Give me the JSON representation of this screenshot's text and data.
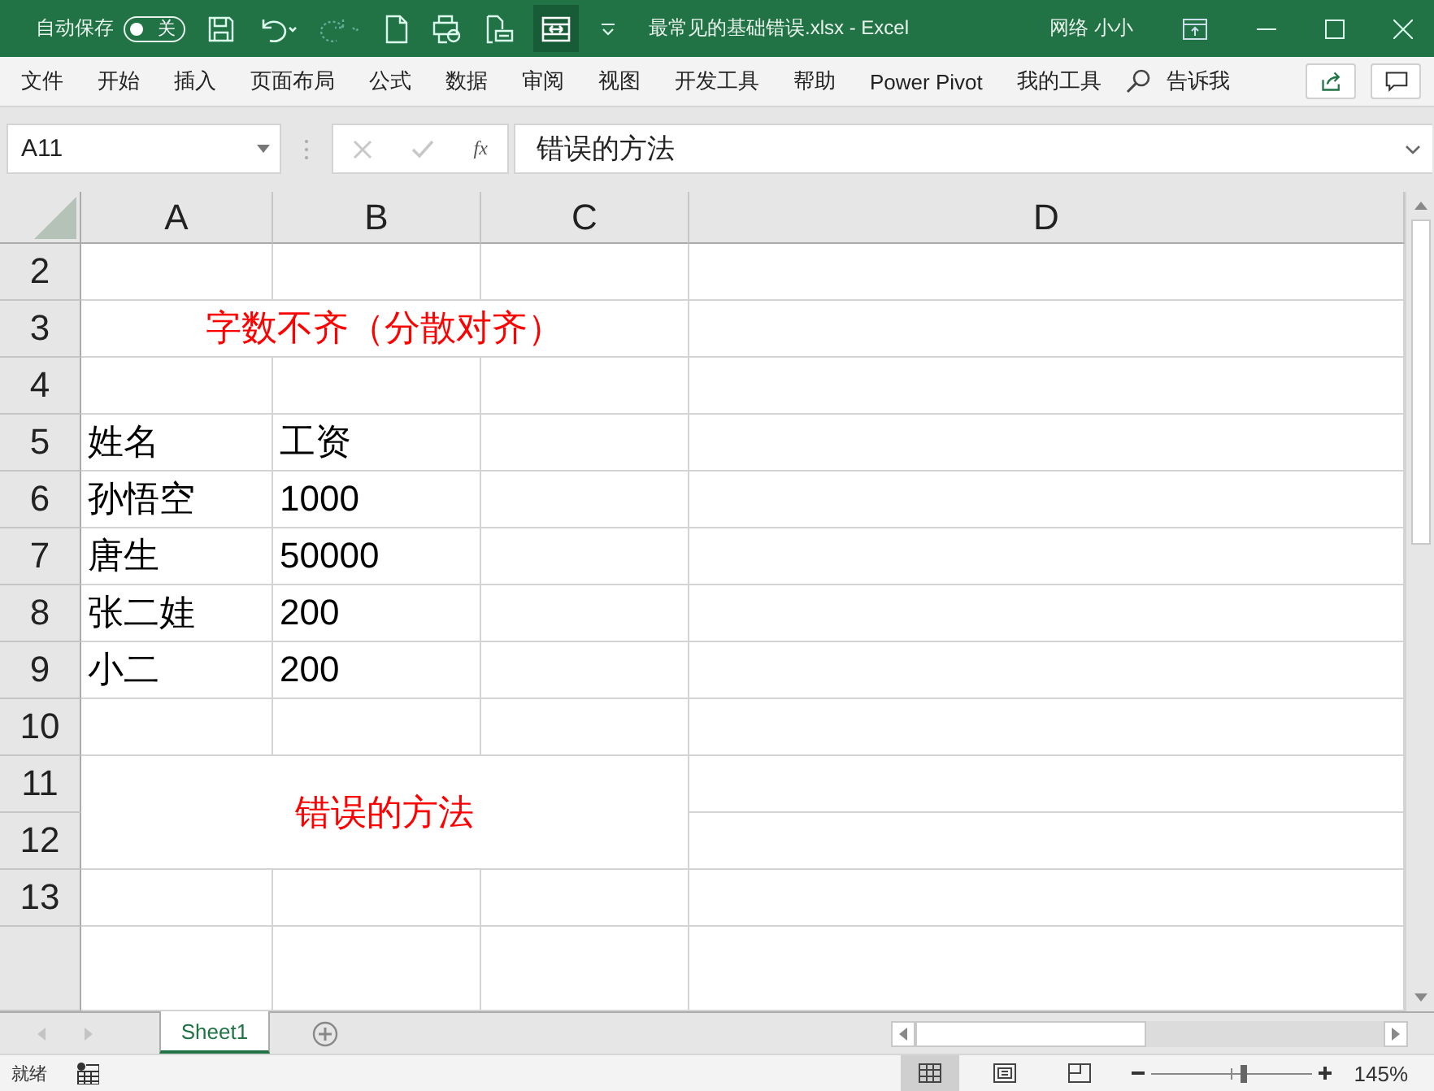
{
  "title_bar": {
    "autosave_label": "自动保存",
    "autosave_toggle": {
      "label": "关",
      "on": false
    },
    "document_title": "最常见的基础错误.xlsx  -  Excel",
    "user": "网络 小小"
  },
  "ribbon_tabs": [
    {
      "label": "文件",
      "selected": false
    },
    {
      "label": "开始",
      "selected": false
    },
    {
      "label": "插入",
      "selected": false
    },
    {
      "label": "页面布局",
      "selected": false
    },
    {
      "label": "公式",
      "selected": false
    },
    {
      "label": "数据",
      "selected": false
    },
    {
      "label": "审阅",
      "selected": false
    },
    {
      "label": "视图",
      "selected": false
    },
    {
      "label": "开发工具",
      "selected": false
    },
    {
      "label": "帮助",
      "selected": false
    },
    {
      "label": "Power Pivot",
      "selected": false
    },
    {
      "label": "我的工具",
      "selected": false
    }
  ],
  "tell_me": {
    "placeholder": "告诉我"
  },
  "formula_bar": {
    "name_box": "A11",
    "function_label": "fx",
    "formula": "错误的方法"
  },
  "columns": [
    "A",
    "B",
    "C",
    "D"
  ],
  "rows": [
    {
      "header": "2",
      "kind": "plain"
    },
    {
      "header": "3",
      "kind": "merged",
      "text": "字数不齐（分散对齐）",
      "color": "#ff0000"
    },
    {
      "header": "4",
      "kind": "plain"
    },
    {
      "header": "5",
      "kind": "plain",
      "cells": [
        "姓名",
        "工资"
      ]
    },
    {
      "header": "6",
      "kind": "plain",
      "cells": [
        "孙悟空",
        "1000"
      ]
    },
    {
      "header": "7",
      "kind": "plain",
      "cells": [
        "唐生",
        "50000"
      ]
    },
    {
      "header": "8",
      "kind": "plain",
      "cells": [
        "张二娃",
        "200"
      ]
    },
    {
      "header": "9",
      "kind": "plain",
      "cells": [
        "小二",
        "200"
      ]
    },
    {
      "header": "10",
      "kind": "plain"
    },
    {
      "header": "11",
      "kind": "merged_start",
      "text": "错误的方法",
      "color": "#ff0000"
    },
    {
      "header": "12",
      "kind": "merged_end"
    },
    {
      "header": "13",
      "kind": "plain"
    }
  ],
  "sheet_tabs": [
    {
      "label": "Sheet1",
      "selected": true
    }
  ],
  "status_bar": {
    "status": "就绪",
    "views": [
      {
        "kind": "normal",
        "selected": true
      },
      {
        "kind": "page_layout",
        "selected": false
      },
      {
        "kind": "page_break",
        "selected": false
      }
    ],
    "zoom": {
      "level": 0.58,
      "reading": "145%"
    }
  }
}
